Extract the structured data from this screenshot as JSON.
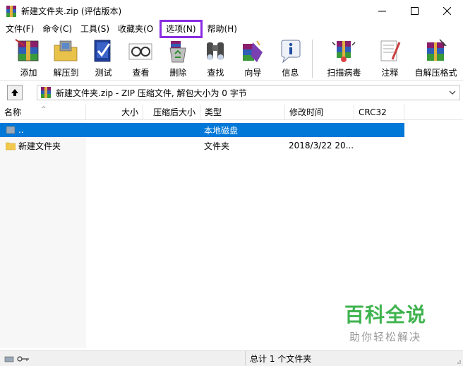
{
  "window": {
    "title": "新建文件夹.zip (评估版本)",
    "minimize": "—",
    "maximize": "☐",
    "close": "✕"
  },
  "menu": [
    "文件(F)",
    "命令(C)",
    "工具(S)",
    "收藏夹(O",
    "选项(N)",
    "帮助(H)"
  ],
  "toolbar": [
    "添加",
    "解压到",
    "测试",
    "查看",
    "删除",
    "查找",
    "向导",
    "信息",
    "扫描病毒",
    "注释",
    "自解压格式"
  ],
  "address": {
    "text": "新建文件夹.zip - ZIP 压缩文件, 解包大小为 0 字节"
  },
  "columns": [
    "名称",
    "大小",
    "压缩后大小",
    "类型",
    "修改时间",
    "CRC32"
  ],
  "rows": [
    {
      "name": "..",
      "size": "",
      "packed": "",
      "type": "本地磁盘",
      "modified": "",
      "crc": ""
    },
    {
      "name": "新建文件夹",
      "size": "",
      "packed": "",
      "type": "文件夹",
      "modified": "2018/3/22 20...",
      "crc": ""
    }
  ],
  "status": {
    "text": "总计 1 个文件夹"
  },
  "watermark": {
    "title": "百科全说",
    "subtitle": "助你轻松解决"
  },
  "colors": {
    "highlight_box": "#8a2be2",
    "selection": "#0078d7",
    "watermark_green": "#3fb34f"
  }
}
